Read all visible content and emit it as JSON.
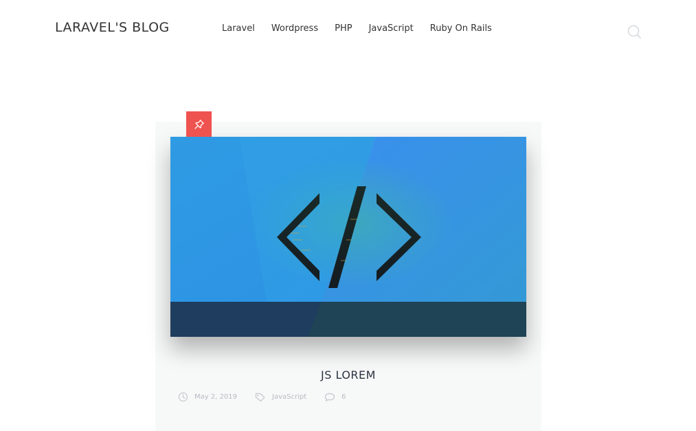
{
  "site": {
    "logo": "LARAVEL'S BLOG"
  },
  "nav": {
    "items": [
      {
        "label": "Laravel"
      },
      {
        "label": "Wordpress"
      },
      {
        "label": "PHP"
      },
      {
        "label": "JavaScript"
      },
      {
        "label": "Ruby On Rails"
      }
    ]
  },
  "header_icons": {
    "search": "search-icon"
  },
  "post": {
    "badge_icon": "pin-icon",
    "badge_color": "#ef5350",
    "image_alt": "code-brackets-illustration",
    "title": "JS LOREM",
    "date": "May 2, 2019",
    "category": "JavaScript",
    "comments": "6"
  }
}
